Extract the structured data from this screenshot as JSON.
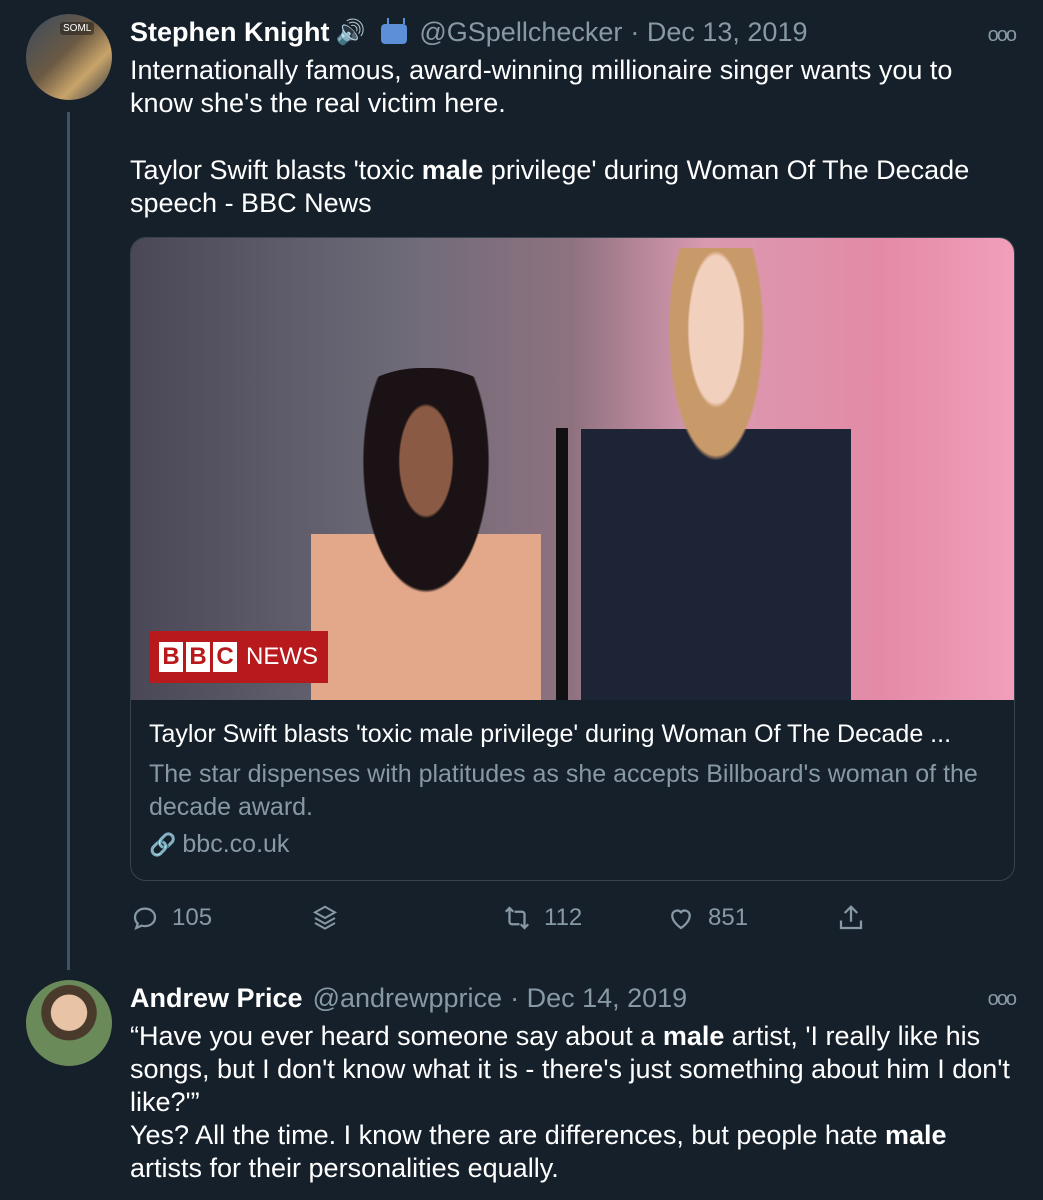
{
  "tweet1": {
    "author_name": "Stephen Knight",
    "handle": "@GSpellchecker",
    "date": "· Dec 13, 2019",
    "avatar_badge": "SOML",
    "line1_a": "Internationally famous, award-winning millionaire singer wants you to know she's the real victim here.",
    "line2_a": "Taylor Swift blasts 'toxic ",
    "line2_bold": "male",
    "line2_b": " privilege' during Woman Of The Decade speech - BBC News",
    "card": {
      "logo_letters": [
        "B",
        "B",
        "C"
      ],
      "logo_news": "NEWS",
      "title": "Taylor Swift blasts 'toxic male privilege' during Woman Of The Decade ...",
      "description": "The star dispenses with platitudes as she accepts Billboard's woman of the decade award.",
      "link": "bbc.co.uk"
    },
    "actions": {
      "replies": "105",
      "retweets": "112",
      "likes": "851"
    }
  },
  "tweet2": {
    "author_name": "Andrew Price",
    "handle": "@andrewpprice",
    "date": "· Dec 14, 2019",
    "text_a": "“Have you ever heard someone say about a ",
    "text_bold1": "male",
    "text_b": " artist, 'I really like his songs, but I don't know what it is - there's just something about him I don't like?'”",
    "text_c": "Yes? All the time. I know there are differences, but people hate ",
    "text_bold2": "male",
    "text_d": " artists for their personalities equally."
  },
  "icons": {
    "more": "more-horizontal-icon",
    "speaker": "speaker-icon",
    "tv": "tv-icon",
    "reply": "reply-icon",
    "stack": "layers-icon",
    "retweet": "retweet-icon",
    "like": "heart-icon",
    "share": "share-icon",
    "link": "link-icon"
  },
  "colors": {
    "background": "#15202b",
    "muted": "#8899a6",
    "border": "#38444d",
    "bbc_red": "#b8191c"
  }
}
